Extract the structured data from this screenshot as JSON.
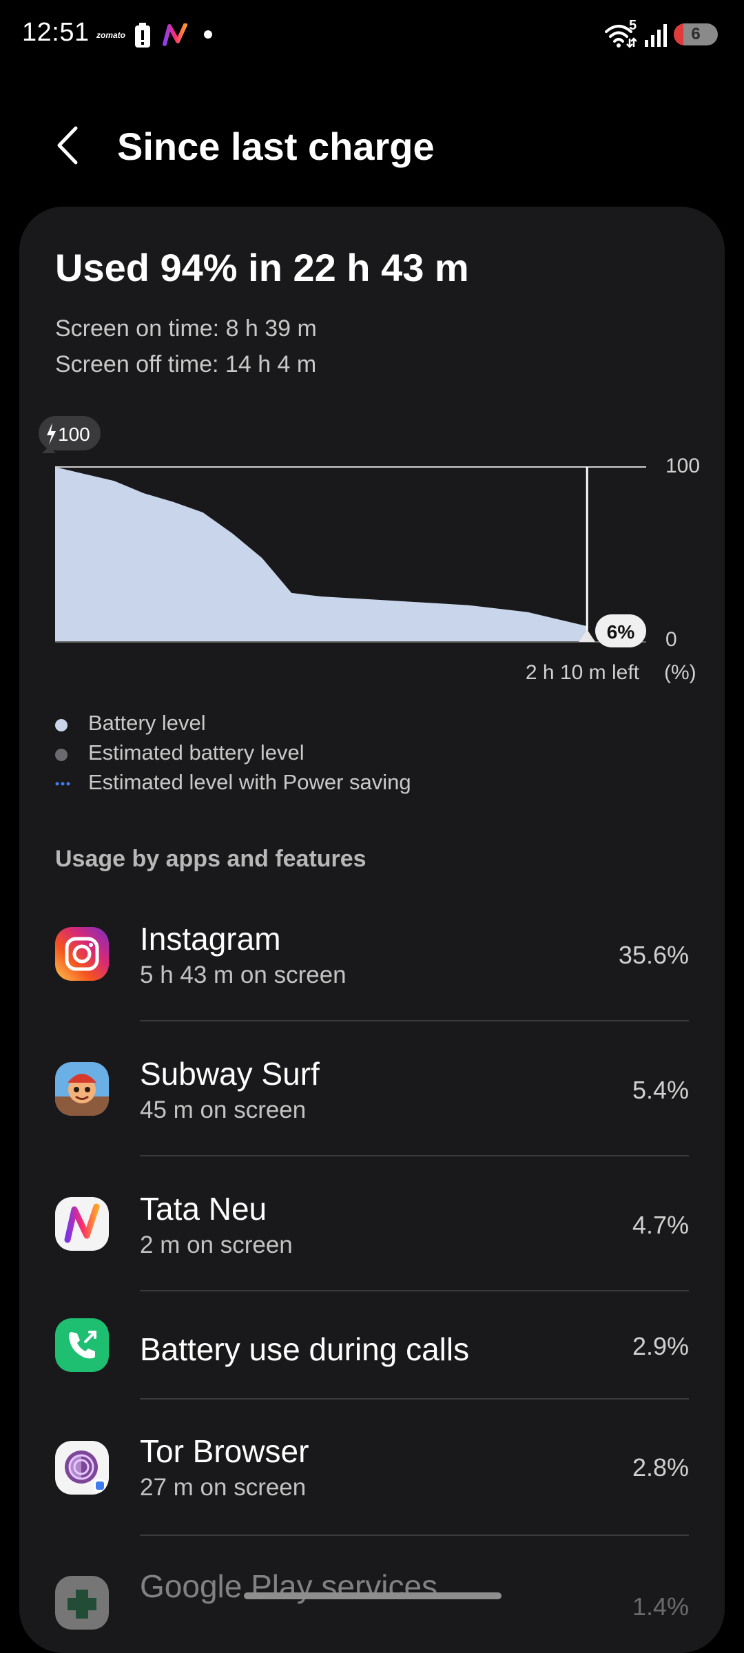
{
  "status_bar": {
    "time": "12:51",
    "zomato_label": "zomato",
    "wifi_badge": "5",
    "battery_level": "6",
    "icons": [
      "zomato-icon",
      "battery-saver-icon",
      "tata-neu-icon",
      "dot-icon",
      "wifi-icon",
      "signal-icon",
      "battery-icon"
    ]
  },
  "header": {
    "back_icon": "chevron-left-icon",
    "title": "Since last charge"
  },
  "summary": {
    "used": "Used 94% in 22 h 43 m",
    "screen_on": "Screen on time: 8 h 39 m",
    "screen_off": "Screen off time: 14 h 4 m"
  },
  "chart_data": {
    "type": "area",
    "start_badge": "100",
    "current_badge": "6%",
    "ymax_label": "100",
    "ymin_label": "0",
    "unit_label": "(%)",
    "time_left_label": "2 h 10 m left",
    "ylim": [
      0,
      100
    ],
    "x_fraction": [
      0.0,
      0.05,
      0.1,
      0.15,
      0.2,
      0.25,
      0.3,
      0.35,
      0.4,
      0.45,
      0.5,
      0.55,
      0.6,
      0.65,
      0.7,
      0.75,
      0.8,
      0.85,
      0.9,
      0.95,
      1.0
    ],
    "values": [
      100,
      96,
      92,
      85,
      80,
      74,
      62,
      48,
      28,
      26,
      25,
      24,
      23,
      22,
      21,
      19,
      17,
      13,
      9,
      6,
      6
    ],
    "current_x_fraction": 0.9,
    "colors": {
      "battery_fill": "#c8d5ea",
      "estimated": "#6b6b6f",
      "power_saving": "#3d7df1"
    }
  },
  "legend": [
    {
      "label": "Battery level",
      "color": "#c8d5ea",
      "style": "dot"
    },
    {
      "label": "Estimated battery level",
      "color": "#6b6b6f",
      "style": "dot"
    },
    {
      "label": "Estimated level with Power saving",
      "color": "#3d7df1",
      "style": "dashes"
    }
  ],
  "usage": {
    "title": "Usage by apps and features",
    "apps": [
      {
        "name": "Instagram",
        "sub": "5 h 43 m on screen",
        "percent": "35.6%",
        "icon": "instagram-icon"
      },
      {
        "name": "Subway Surf",
        "sub": "45 m on screen",
        "percent": "5.4%",
        "icon": "subway-surf-icon"
      },
      {
        "name": "Tata Neu",
        "sub": "2 m on screen",
        "percent": "4.7%",
        "icon": "tata-neu-icon"
      },
      {
        "name": "Battery use during calls",
        "sub": "",
        "percent": "2.9%",
        "icon": "phone-icon"
      },
      {
        "name": "Tor Browser",
        "sub": "27 m on screen",
        "percent": "2.8%",
        "icon": "tor-browser-icon"
      },
      {
        "name": "Google Play services",
        "sub": "",
        "percent": "1.4%",
        "icon": "google-play-services-icon"
      }
    ]
  }
}
